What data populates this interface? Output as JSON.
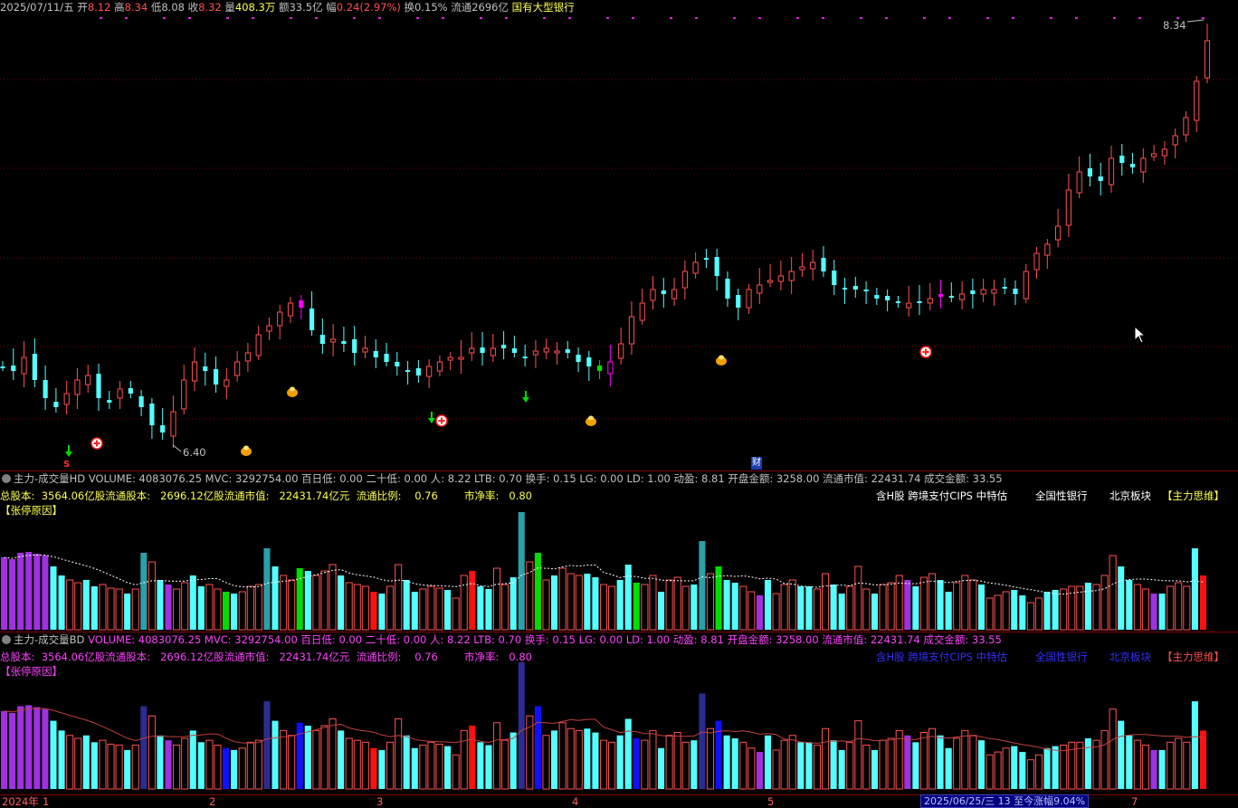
{
  "quote": {
    "date": "2025/07/11/五",
    "open_label": "开",
    "open": "8.12",
    "high_label": "高",
    "high": "8.34",
    "low_label": "低",
    "low": "8.08",
    "close_label": "收",
    "close": "8.32",
    "volume_label": "量",
    "volume": "408.3万",
    "amount_label": "额",
    "amount": "33.5亿",
    "change_label": "幅",
    "change": "0.24(2.97%)",
    "turnover_label": "换",
    "turnover": "0.15%",
    "float_label": "流通",
    "float": "2696亿",
    "sector": "国有大型银行"
  },
  "price_chart": {
    "high_marker": "8.34",
    "low_marker": "6.40",
    "event_s": "S",
    "event_cai": "财"
  },
  "panel1": {
    "name": "主力-成交量HD",
    "stats": "VOLUME: 4083076.25  MVC: 3292754.00  百日低: 0.00  二十低: 0.00  人: 8.22  LTB: 0.70  换手: 0.15  LG: 0.00  LD: 1.00  动盈: 8.81  开盘金额: 3258.00  流通市值: 22431.74  成交金额: 33.55",
    "info": [
      {
        "k": "总股本:",
        "v": "3564.06亿"
      },
      {
        "k": "股流通股本:",
        "v": "2696.12亿"
      },
      {
        "k": "股流通市值:",
        "v": "22431.74亿元"
      },
      {
        "k": "流通比例:",
        "v": "0.76"
      },
      {
        "k": "市净率:",
        "v": "0.80"
      }
    ],
    "tags": [
      "含H股 跨境支付CIPS 中特估",
      "全国性银行",
      "北京板块",
      "【主力思维】"
    ],
    "reason": "【张停原因】"
  },
  "panel2": {
    "name": "主力-成交量BD",
    "stats": "VOLUME: 4083076.25  MVC: 3292754.00  百日低: 0.00  二十低: 0.00  人: 8.22  LTB: 0.70  换手: 0.15  LG: 0.00  LD: 1.00  动盈: 8.81  开盘金额: 3258.00  流通市值: 22431.74  成交金额: 33.55",
    "info": [
      {
        "k": "总股本:",
        "v": "3564.06亿"
      },
      {
        "k": "股流通股本:",
        "v": "2696.12亿"
      },
      {
        "k": "股流通市值:",
        "v": "22431.74亿元"
      },
      {
        "k": "流通比例:",
        "v": "0.76"
      },
      {
        "k": "市净率:",
        "v": "0.80"
      }
    ],
    "tags": [
      "含H股 跨境支付CIPS 中特估",
      "全国性银行",
      "北京板块",
      "【主力思维】"
    ],
    "reason": "【张停原因】"
  },
  "timeline": {
    "labels": [
      "2024年",
      "1",
      "2",
      "3",
      "4",
      "5",
      "7"
    ],
    "info": "2025/06/25/三 13 至今涨幅9.04%"
  },
  "colors": {
    "up": "#ff5050",
    "down": "#54ffff",
    "magenta": "#ff00ff",
    "purple": "#a030e0",
    "green": "#00dd00",
    "red": "#ff1010",
    "teal": "#2aa0a8",
    "white": "#ffffff",
    "navy": "#2c2c90",
    "blue": "#1010ff"
  }
}
